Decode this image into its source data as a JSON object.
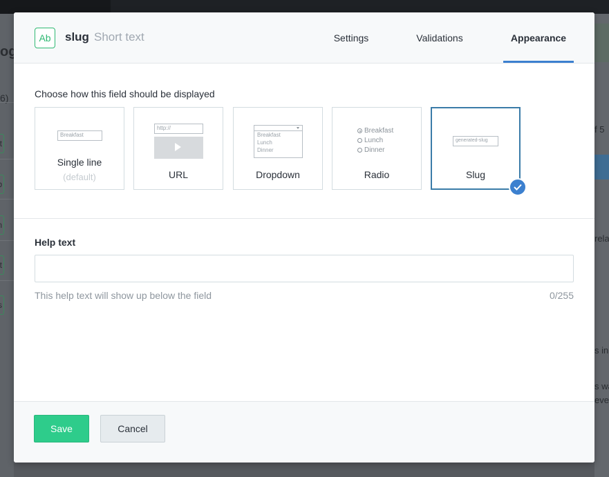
{
  "background": {
    "left_title": "og",
    "left_count": "6)",
    "left_badges": [
      "t",
      "b",
      "n",
      "t",
      "s"
    ],
    "right_texts": [
      "f 5",
      "rela",
      "s in",
      "s wa",
      "eve"
    ]
  },
  "header": {
    "field_icon_text": "Ab",
    "field_name": "slug",
    "field_type": "Short text",
    "tabs": [
      {
        "label": "Settings",
        "active": false
      },
      {
        "label": "Validations",
        "active": false
      },
      {
        "label": "Appearance",
        "active": true
      }
    ]
  },
  "appearance": {
    "prompt": "Choose how this field should be displayed",
    "options": [
      {
        "label": "Single line",
        "sublabel": "(default)",
        "preview_text": "Breakfast",
        "selected": false
      },
      {
        "label": "URL",
        "preview_text": "http://",
        "selected": false
      },
      {
        "label": "Dropdown",
        "preview_items": [
          "Breakfast",
          "Lunch",
          "Dinner"
        ],
        "selected": false
      },
      {
        "label": "Radio",
        "preview_items": [
          "Breakfast",
          "Lunch",
          "Dinner"
        ],
        "selected": false
      },
      {
        "label": "Slug",
        "preview_text": "generated-slug",
        "selected": true
      }
    ]
  },
  "help": {
    "label": "Help text",
    "value": "",
    "placeholder": "",
    "hint": "This help text will show up below the field",
    "counter": "0/255"
  },
  "footer": {
    "save_label": "Save",
    "cancel_label": "Cancel"
  },
  "colors": {
    "accent_blue": "#3c80cf",
    "save_green": "#2ecc8b",
    "field_icon_green": "#2eb872"
  }
}
